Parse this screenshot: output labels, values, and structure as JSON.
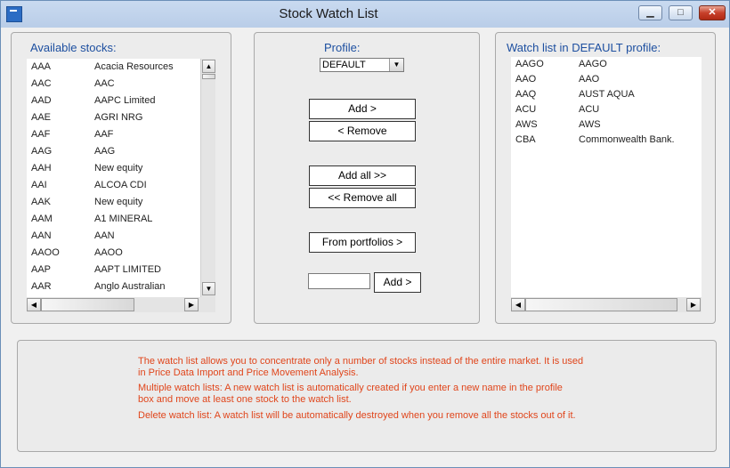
{
  "window": {
    "title": "Stock Watch List",
    "min_glyph": "▁",
    "max_glyph": "□",
    "close_glyph": "✕"
  },
  "available": {
    "label": "Available stocks:",
    "items": [
      {
        "code": "AAA",
        "name": "Acacia Resources"
      },
      {
        "code": "AAC",
        "name": "AAC"
      },
      {
        "code": "AAD",
        "name": "AAPC Limited"
      },
      {
        "code": "AAE",
        "name": "AGRI NRG"
      },
      {
        "code": "AAF",
        "name": "AAF"
      },
      {
        "code": "AAG",
        "name": "AAG"
      },
      {
        "code": "AAH",
        "name": "New equity"
      },
      {
        "code": "AAI",
        "name": "ALCOA CDI"
      },
      {
        "code": "AAK",
        "name": "New equity"
      },
      {
        "code": "AAM",
        "name": "A1 MINERAL"
      },
      {
        "code": "AAN",
        "name": "AAN"
      },
      {
        "code": "AAOO",
        "name": "AAOO"
      },
      {
        "code": "AAP",
        "name": "AAPT LIMITED"
      },
      {
        "code": "AAR",
        "name": "Anglo Australian"
      }
    ]
  },
  "profile": {
    "label": "Profile:",
    "selected": "DEFAULT",
    "add_label": "Add >",
    "remove_label": "< Remove",
    "add_all_label": "Add all >>",
    "remove_all_label": "<< Remove all",
    "from_portfolios_label": "From portfolios >",
    "manual_add_label": "Add >",
    "manual_value": ""
  },
  "watchlist": {
    "label": "Watch list in DEFAULT profile:",
    "items": [
      {
        "code": "AAGO",
        "name": "AAGO"
      },
      {
        "code": "AAO",
        "name": "AAO"
      },
      {
        "code": "AAQ",
        "name": "AUST AQUA"
      },
      {
        "code": "ACU",
        "name": "ACU"
      },
      {
        "code": "AWS",
        "name": "AWS"
      },
      {
        "code": "CBA",
        "name": "Commonwealth Bank."
      }
    ]
  },
  "info": {
    "line1": "The watch list allows you to concentrate only a number of stocks instead of the entire market. It is used",
    "line2": "in Price Data Import and Price Movement Analysis.",
    "line3": "Multiple watch lists: A new watch list is automatically created if you enter a new name in the profile",
    "line4": "box and move at least one stock to the watch list.",
    "line5": "Delete watch list: A watch list will be automatically destroyed when you remove all the stocks out of it."
  },
  "colors": {
    "accent_blue": "#1d4fa0",
    "info_text": "#e0451b"
  },
  "icons": {
    "up": "▲",
    "down": "▼",
    "left": "◀",
    "right": "▶",
    "dropdown": "▼"
  }
}
